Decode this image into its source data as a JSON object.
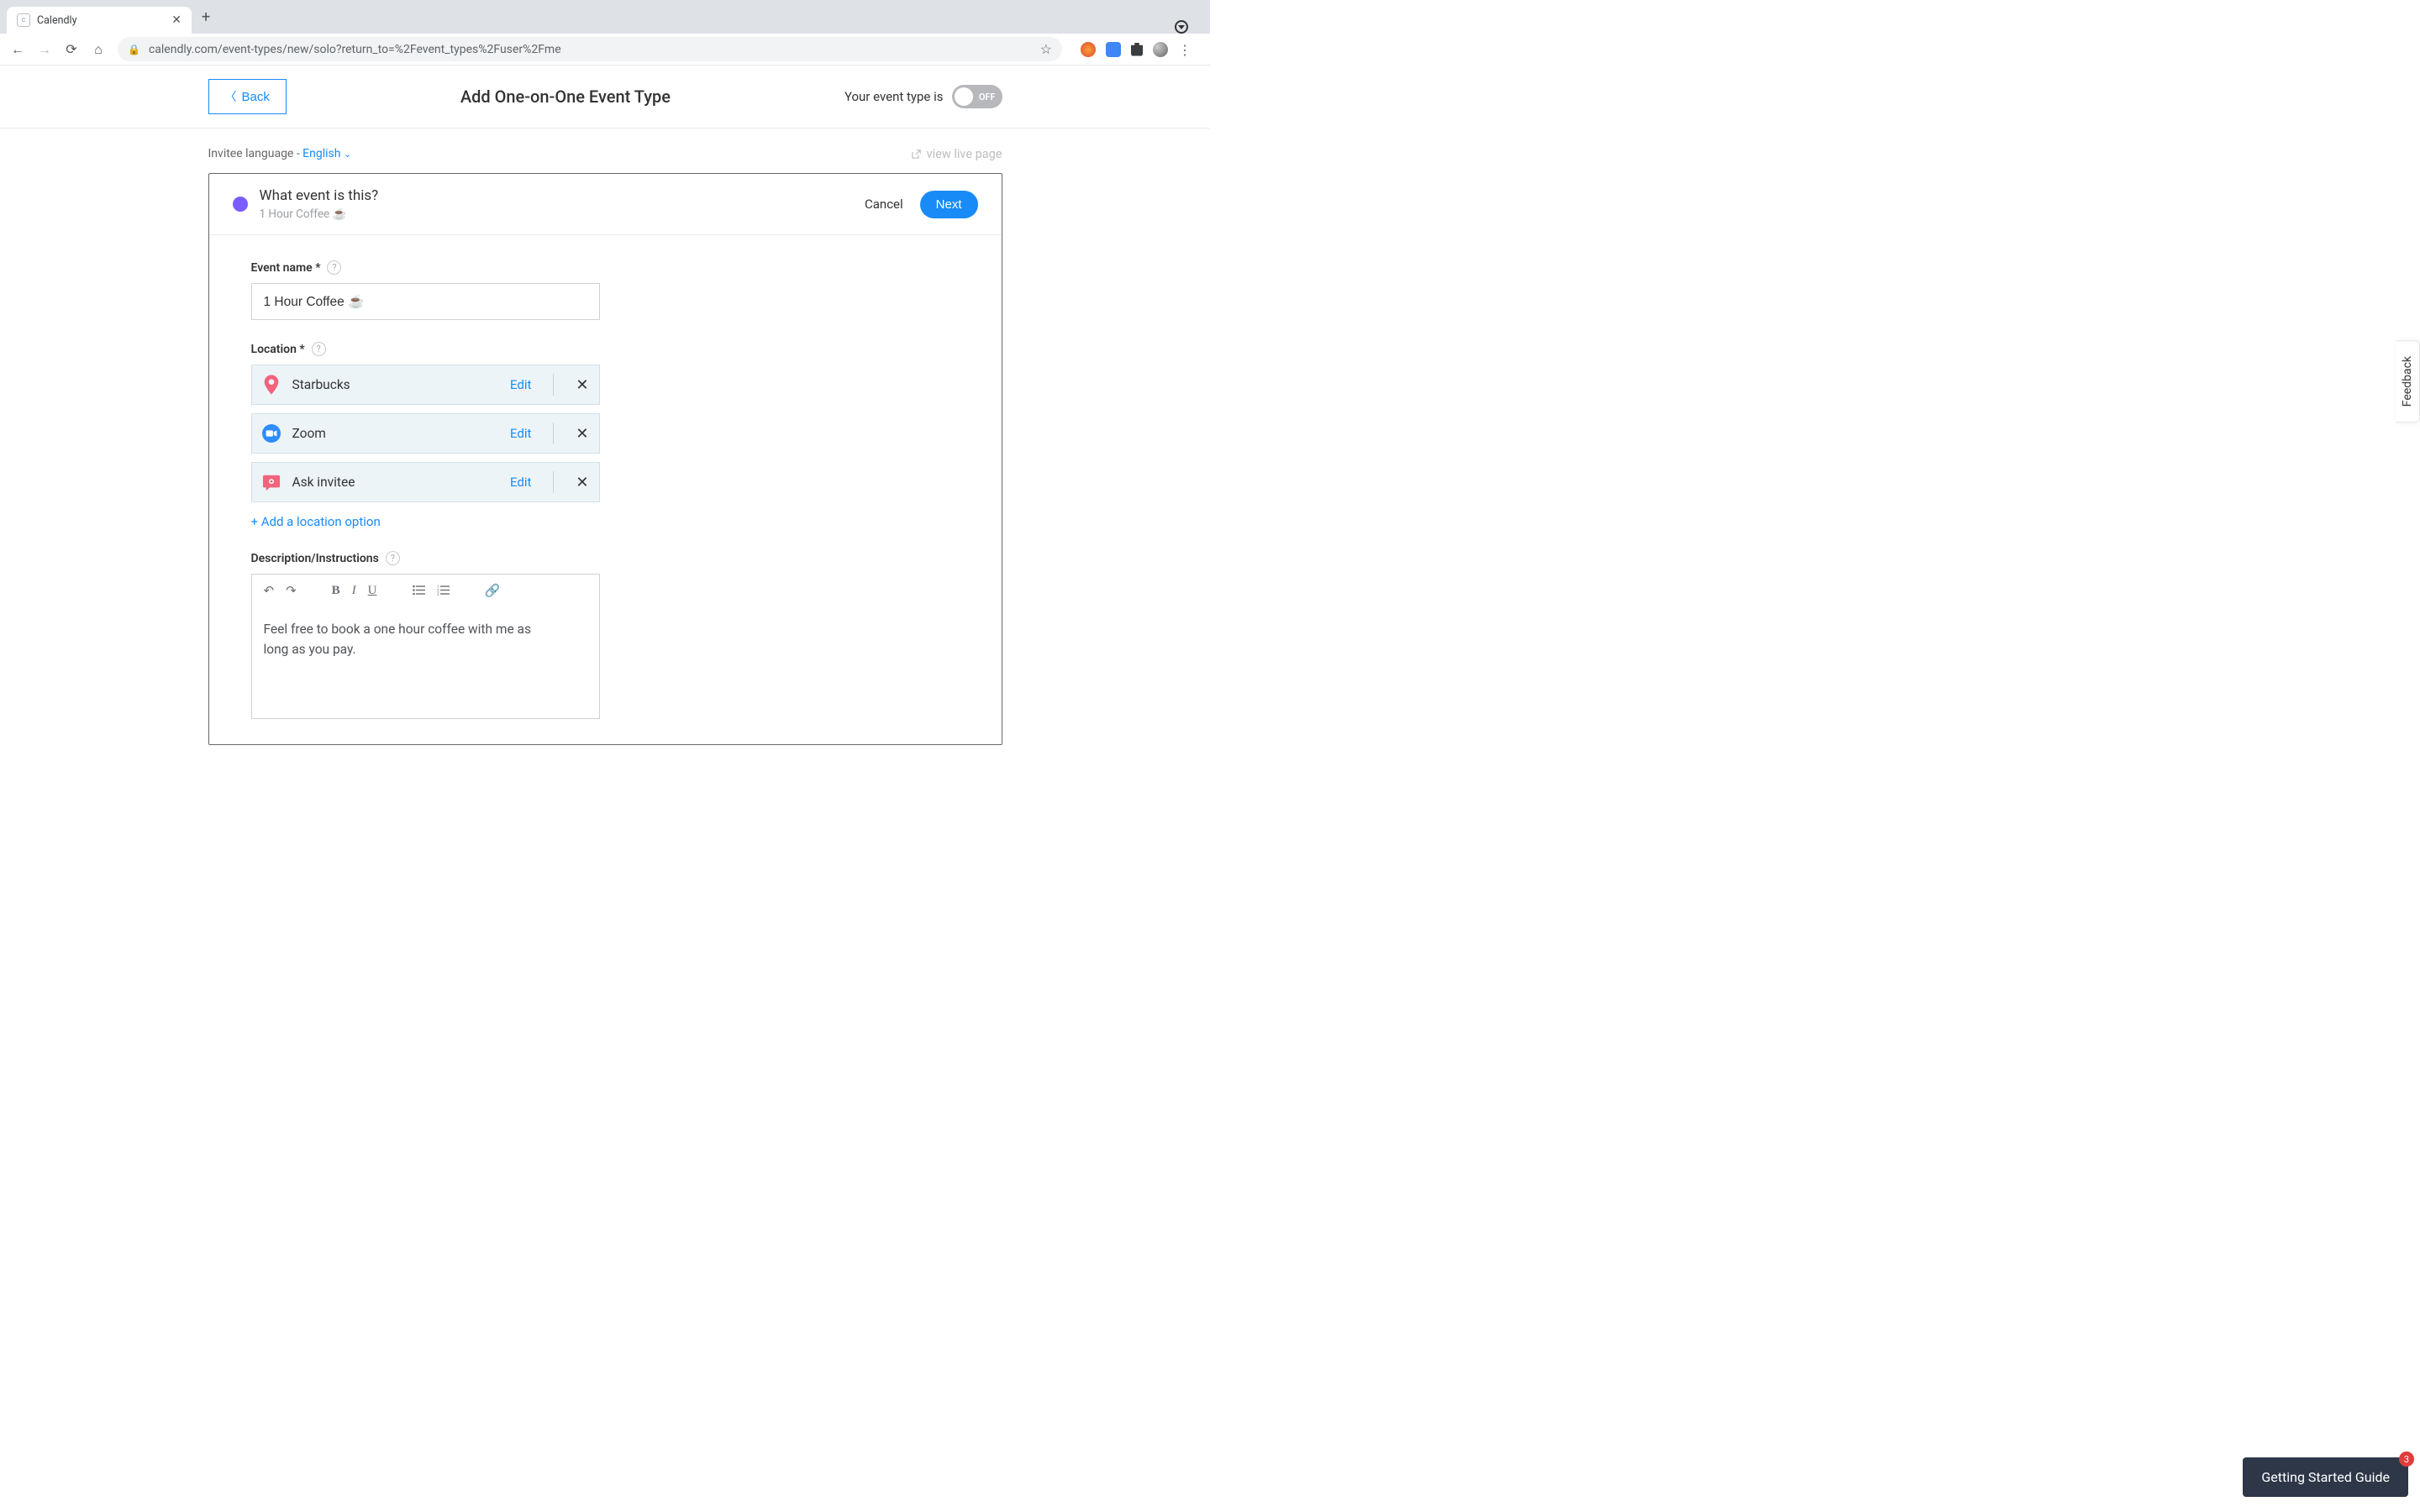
{
  "browser": {
    "tab_title": "Calendly",
    "url": "calendly.com/event-types/new/solo?return_to=%2Fevent_types%2Fuser%2Fme"
  },
  "header": {
    "back_label": "Back",
    "page_title": "Add One-on-One Event Type",
    "status_label": "Your event type is",
    "toggle_text": "OFF"
  },
  "subrow": {
    "invitee_prefix": "Invitee language - ",
    "language_link": "English",
    "live_link": "view live page"
  },
  "card": {
    "question": "What event is this?",
    "subtitle": "1 Hour Coffee ☕",
    "cancel": "Cancel",
    "next": "Next"
  },
  "form": {
    "event_name_label": "Event name *",
    "event_name_value": "1 Hour Coffee ☕",
    "location_label": "Location *",
    "locations": [
      {
        "icon": "pin",
        "name": "Starbucks",
        "edit": "Edit"
      },
      {
        "icon": "zoom",
        "name": "Zoom",
        "edit": "Edit"
      },
      {
        "icon": "ask",
        "name": "Ask invitee",
        "edit": "Edit"
      }
    ],
    "add_location": "+ Add a location option",
    "description_label": "Description/Instructions",
    "description_value": "Feel free to book a one hour coffee with me as long as you pay."
  },
  "feedback_tab": "Feedback",
  "guide": {
    "label": "Getting Started Guide",
    "badge": "3"
  }
}
